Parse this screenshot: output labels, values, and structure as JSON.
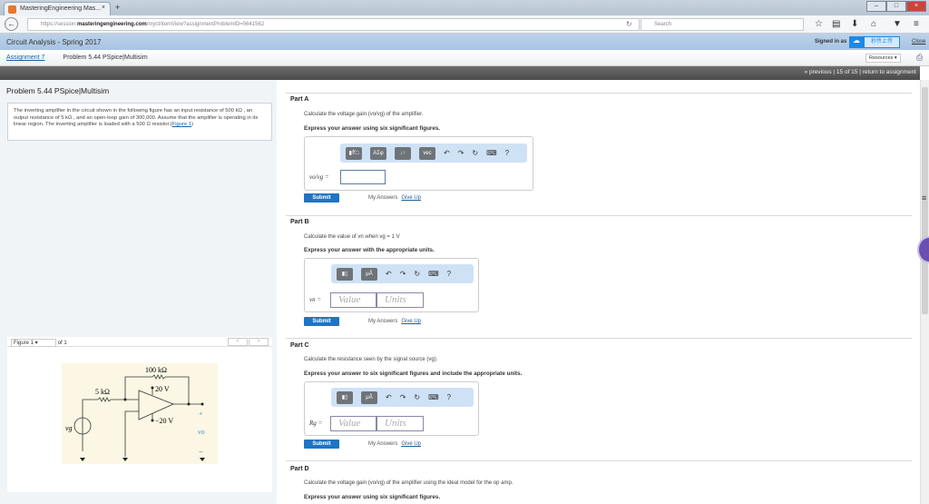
{
  "browser": {
    "tab_title": "MasteringEngineering Mas...",
    "new_tab": "+",
    "url_prefix": "https://session.",
    "url_domain": "masteringengineering.com",
    "url_path": "/myct/itemView?assignmentProblemID=5641562",
    "search_placeholder": "Search"
  },
  "header": {
    "course": "Circuit Analysis - Spring 2017",
    "signed_in": "Signed in as ",
    "cloud_label": "秒传上传",
    "close": "Close"
  },
  "breadcrumb": {
    "assignment": "Assignment 7",
    "problem": "Problem 5.44 PSpice|Multisim",
    "resources": "Resources"
  },
  "nav": {
    "previous": "« previous",
    "position": "15 of 15",
    "return": "return to assignment"
  },
  "problem": {
    "title": "Problem 5.44 PSpice|Multisim",
    "text": "The inverting amplifier in the circuit shown in the following figure has an input resistance of 500 kΩ , an output resistance of 5 kΩ , and an open-loop gain of 300,000. Assume that the amplifier is operating in its linear region. The inverting amplifier is loaded with a 500 Ω resistor.",
    "figure_link": "Figure 1"
  },
  "figure": {
    "select": "Figure 1",
    "of": "of 1",
    "prev": "<",
    "next": ">",
    "labels": {
      "r_feedback": "100 kΩ",
      "r_in": "5 kΩ",
      "v_pos": "20 V",
      "v_neg": "−20 V",
      "source": "vg",
      "output": "vo",
      "plus": "+",
      "minus": "−"
    }
  },
  "parts": [
    {
      "label": "Part A",
      "text": "Calculate the voltage gain (vo/vg) of the amplifier.",
      "instruction": "Express your answer using six significant figures.",
      "var": "vo/vg =",
      "toolbar": [
        "▮∜□",
        "AΣφ",
        "↓↑",
        "vec"
      ]
    },
    {
      "label": "Part B",
      "text": "Calculate the value of vn when vg = 1 V",
      "instruction": "Express your answer with the appropriate units.",
      "var": "vn =",
      "value_ph": "Value",
      "units_ph": "Units",
      "toolbar": [
        "▮▯",
        "μÅ"
      ]
    },
    {
      "label": "Part C",
      "text": "Calculate the resistance seen by the signal source (vg).",
      "instruction": "Express your answer to six significant figures and include the appropriate units.",
      "var": "Rg =",
      "value_ph": "Value",
      "units_ph": "Units",
      "toolbar": [
        "▮▯",
        "μÅ"
      ]
    },
    {
      "label": "Part D",
      "text": "Calculate the voltage gain (vo/vg) of the amplifier using the ideal model for the op amp.",
      "instruction": "Express your answer using six significant figures."
    }
  ],
  "common": {
    "submit": "Submit",
    "my_answers": "My Answers",
    "give_up": "Give Up",
    "undo": "↶",
    "redo": "↷",
    "reset": "↻",
    "keyboard": "⌨",
    "help": "?"
  }
}
